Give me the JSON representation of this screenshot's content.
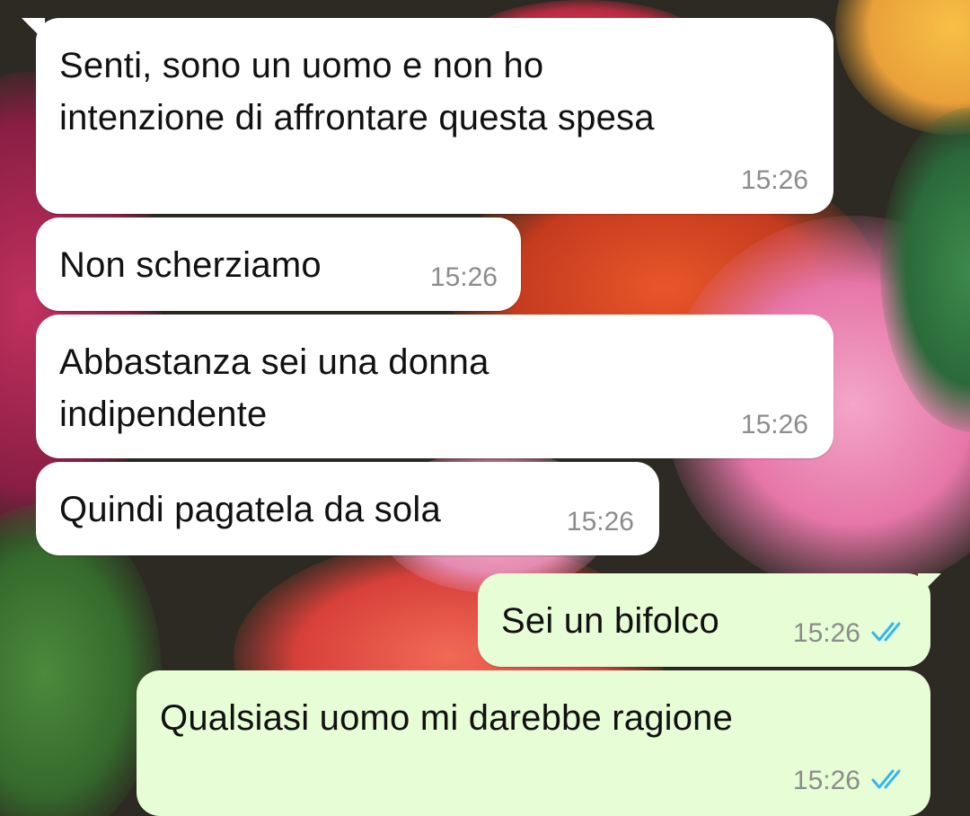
{
  "colors": {
    "incoming_bubble": "#ffffff",
    "outgoing_bubble": "#e7fdd6",
    "timestamp": "#8c8c8c",
    "read_ticks": "#34b7f1"
  },
  "messages": [
    {
      "direction": "incoming",
      "text": "Senti, sono un uomo e non ho\nintenzione di affrontare questa spesa",
      "time": "15:26"
    },
    {
      "direction": "incoming",
      "text": "Non scherziamo",
      "time": "15:26"
    },
    {
      "direction": "incoming",
      "text": "Abbastanza sei una donna\nindipendente",
      "time": "15:26"
    },
    {
      "direction": "incoming",
      "text": "Quindi pagatela da sola",
      "time": "15:26"
    },
    {
      "direction": "outgoing",
      "text": "Sei un bifolco",
      "time": "15:26",
      "status_icon": "double-check-read-icon"
    },
    {
      "direction": "outgoing",
      "text": "Qualsiasi uomo mi darebbe ragione",
      "time": "15:26",
      "status_icon": "double-check-read-icon"
    }
  ]
}
